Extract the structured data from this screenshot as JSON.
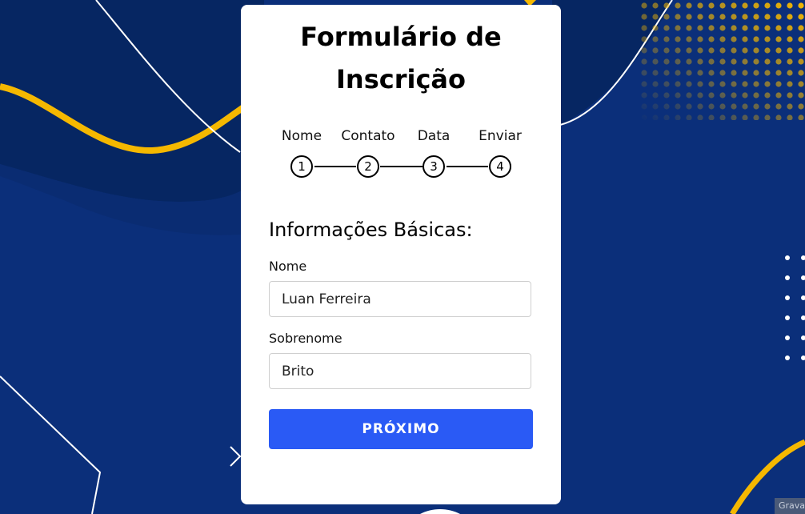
{
  "colors": {
    "background": "#0b2f7a",
    "accent_yellow": "#f5b800",
    "primary_button": "#2a5af5",
    "card": "#ffffff"
  },
  "form": {
    "title": "Formulário de Inscrição",
    "steps": [
      {
        "label": "Nome",
        "number": "1"
      },
      {
        "label": "Contato",
        "number": "2"
      },
      {
        "label": "Data",
        "number": "3"
      },
      {
        "label": "Enviar",
        "number": "4"
      }
    ],
    "section_title": "Informações Básicas:",
    "fields": {
      "first_name": {
        "label": "Nome",
        "value": "Luan Ferreira"
      },
      "last_name": {
        "label": "Sobrenome",
        "value": "Brito"
      }
    },
    "next_button": "PRÓXIMO"
  },
  "corner_badge": "Grava"
}
